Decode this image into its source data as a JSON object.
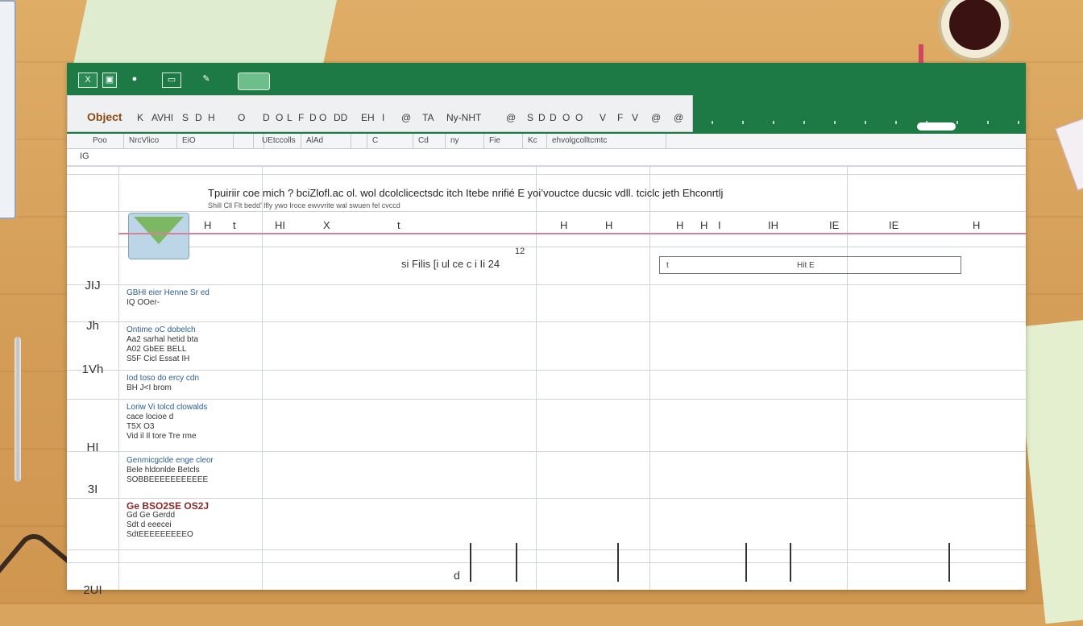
{
  "titlebar": {
    "icons": [
      "app-logo-icon",
      "save-icon",
      "undo-icon",
      "window-icon",
      "brush-icon",
      "battery-icon"
    ]
  },
  "menubar": {
    "first": "Object",
    "items": [
      "K",
      "AVHI",
      "S",
      "D",
      "H",
      "O",
      "D",
      "O",
      "L",
      "F",
      "D",
      "O",
      "DD",
      "EH",
      "I",
      "@",
      "TA",
      "Ny-NHT",
      "@",
      "S",
      "D",
      "D",
      "O",
      "O",
      "V",
      "F",
      "V",
      "@",
      "@"
    ]
  },
  "tabs": [
    "Poo",
    "NrcVlico",
    "EiO",
    "",
    "",
    "UEtccolls",
    "AlAd",
    "",
    "C",
    "Cd",
    "ny",
    "Fie",
    "Kc",
    "ehvolgcolltcmtc"
  ],
  "cellref": "IG",
  "heading": {
    "title": "Tpuiriir coe mich ? bciZlofl.ac ol. wol dcolclicectsdc itch Itebe nrifié E yoi’vouctce ducsic vdll. tciclc jeth Ehconrtlj",
    "subtitle": "Shill Cll Flt bedd’ lfly ywo Iroce ewvvrite wal swuen fel cvccd"
  },
  "row_headers": [
    "JIJ",
    "Jh",
    "1Vh",
    "HI",
    "3I",
    "2UI"
  ],
  "column_headers": [
    "H",
    "t",
    "HI",
    "X",
    "t",
    "H",
    "H",
    "H",
    "H",
    "I",
    "IH",
    "IE",
    "IE",
    "H"
  ],
  "mid": {
    "text": "si Filis [i ul ce c i Ii 24",
    "number": "12"
  },
  "field": {
    "left": "t",
    "right": "Hit E"
  },
  "entries": [
    {
      "title": "GBHI eier Henne Sr ed",
      "lines": [
        "IQ   OOer-"
      ]
    },
    {
      "title": "Ontime oC dobelch",
      "lines": [
        "Aa2 sarhal hetid bta",
        "A02 GbEE BELL",
        "S5F Cicl Essat IH"
      ]
    },
    {
      "title": "Iod toso do ercy cdn",
      "lines": [
        "BH J<I brom"
      ]
    },
    {
      "title": "Loriw Vi tolcd clowalds",
      "lines": [
        "cace locioe d",
        "T5X O3",
        "Vid il Il tore Tre rme"
      ]
    },
    {
      "title": "Genmicgclde enge cleor",
      "lines": [
        "Bele hldonlde Betcls",
        "SOBBEEEEEEEEEEE"
      ]
    },
    {
      "title": "Ge BSO2SE OS2J",
      "lines": [
        "Gd Ge Gerdd",
        "Sdt d eeecei",
        "SdtEEEEEEEEEO"
      ]
    }
  ],
  "bottom_mark": "d"
}
